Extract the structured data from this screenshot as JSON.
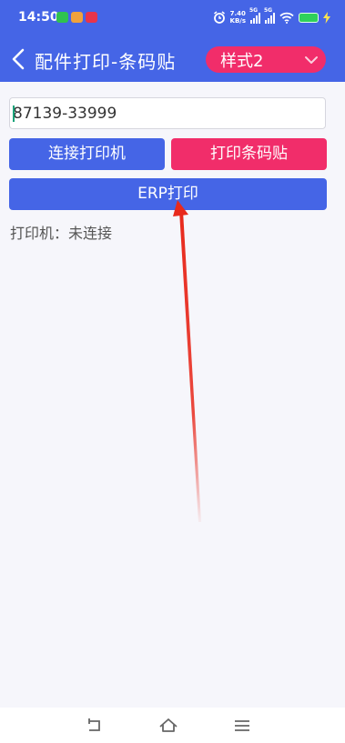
{
  "status_bar": {
    "time": "14:50",
    "net_speed_value": "7.40",
    "net_speed_unit": "KB/s",
    "sim1_label": "5G",
    "sim2_label": "5G",
    "icons": [
      "wechat-icon",
      "app-icon",
      "app-icon",
      "alarm-icon",
      "signal-icon",
      "signal-icon",
      "wifi-icon",
      "battery-icon",
      "charging-icon"
    ]
  },
  "header": {
    "back_icon": "chevron-left-icon",
    "title": "配件打印-条码贴",
    "style_select": {
      "selected": "样式2",
      "icon": "chevron-down-icon"
    }
  },
  "main": {
    "barcode_input": {
      "value": "87139-33999",
      "placeholder": ""
    },
    "buttons": {
      "connect_printer": "连接打印机",
      "print_barcode": "打印条码贴",
      "erp_print": "ERP打印"
    },
    "printer_status": "打印机：未连接"
  },
  "nav_bar": {
    "icons": [
      "back-icon",
      "home-icon",
      "menu-icon"
    ]
  },
  "colors": {
    "primary_blue": "#4565e6",
    "accent_pink": "#f12d6a",
    "background": "#f6f6fb",
    "annotation_red": "#e8291c"
  }
}
